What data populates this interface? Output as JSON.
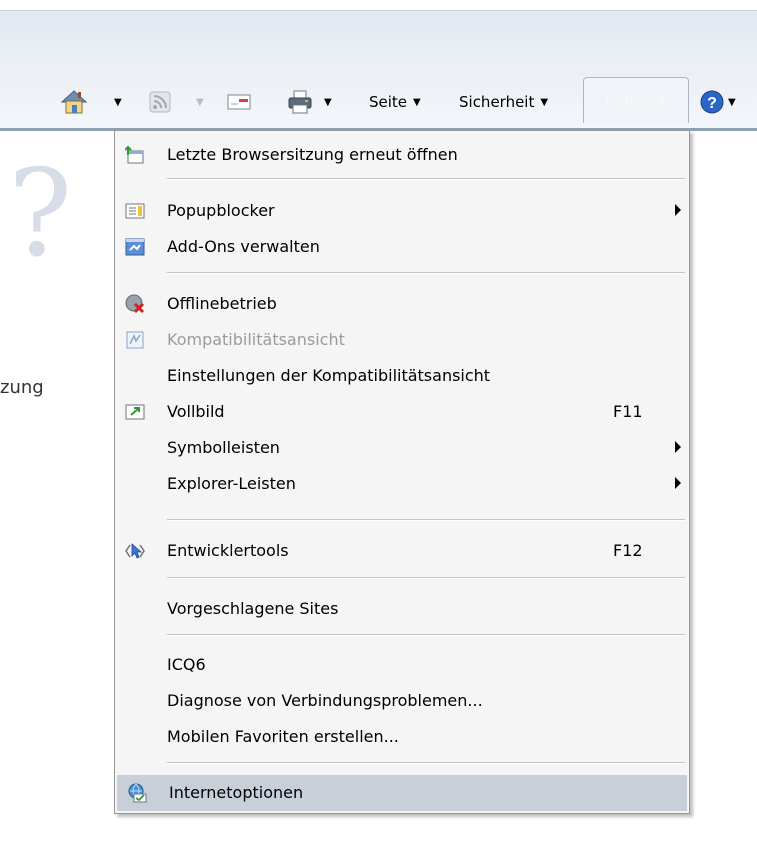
{
  "toolbar": {
    "home_icon": "home-icon",
    "feeds_icon": "feeds-icon",
    "mail_icon": "mail-icon",
    "print_icon": "print-icon",
    "help_icon": "help-icon",
    "dropdown_glyph": "▼",
    "seite_label": "Seite",
    "sicherheit_label": "Sicherheit",
    "extras_label": "Extras",
    "help_glyph": "?"
  },
  "background": {
    "question_mark": "?",
    "partial_text": "zung"
  },
  "menu": {
    "items": [
      {
        "label": "Letzte Browsersitzung erneut öffnen",
        "icon": "reopen-session-icon"
      },
      {
        "label": "Popupblocker",
        "icon": "popup-blocker-icon"
      },
      {
        "label": "Add-Ons verwalten",
        "icon": "addons-icon"
      },
      {
        "label": "Offlinebetrieb",
        "icon": "offline-icon"
      },
      {
        "label": "Kompatibilitätsansicht",
        "icon": "compatibility-view-icon"
      },
      {
        "label": "Einstellungen der Kompatibilitätsansicht"
      },
      {
        "label": "Vollbild",
        "icon": "fullscreen-icon",
        "accelerator": "F11"
      },
      {
        "label": "Symbolleisten"
      },
      {
        "label": "Explorer-Leisten"
      },
      {
        "label": "Entwicklertools",
        "icon": "developer-tools-icon",
        "accelerator": "F12"
      },
      {
        "label": "Vorgeschlagene Sites"
      },
      {
        "label": "ICQ6"
      },
      {
        "label": "Diagnose von Verbindungsproblemen..."
      },
      {
        "label": "Mobilen Favoriten erstellen..."
      },
      {
        "label": "Internetoptionen",
        "icon": "internet-options-icon"
      }
    ]
  },
  "colors": {
    "menu_background": "#f5f5f5",
    "highlight": "#c9cfd9",
    "disabled_text": "#9b9b9b"
  }
}
